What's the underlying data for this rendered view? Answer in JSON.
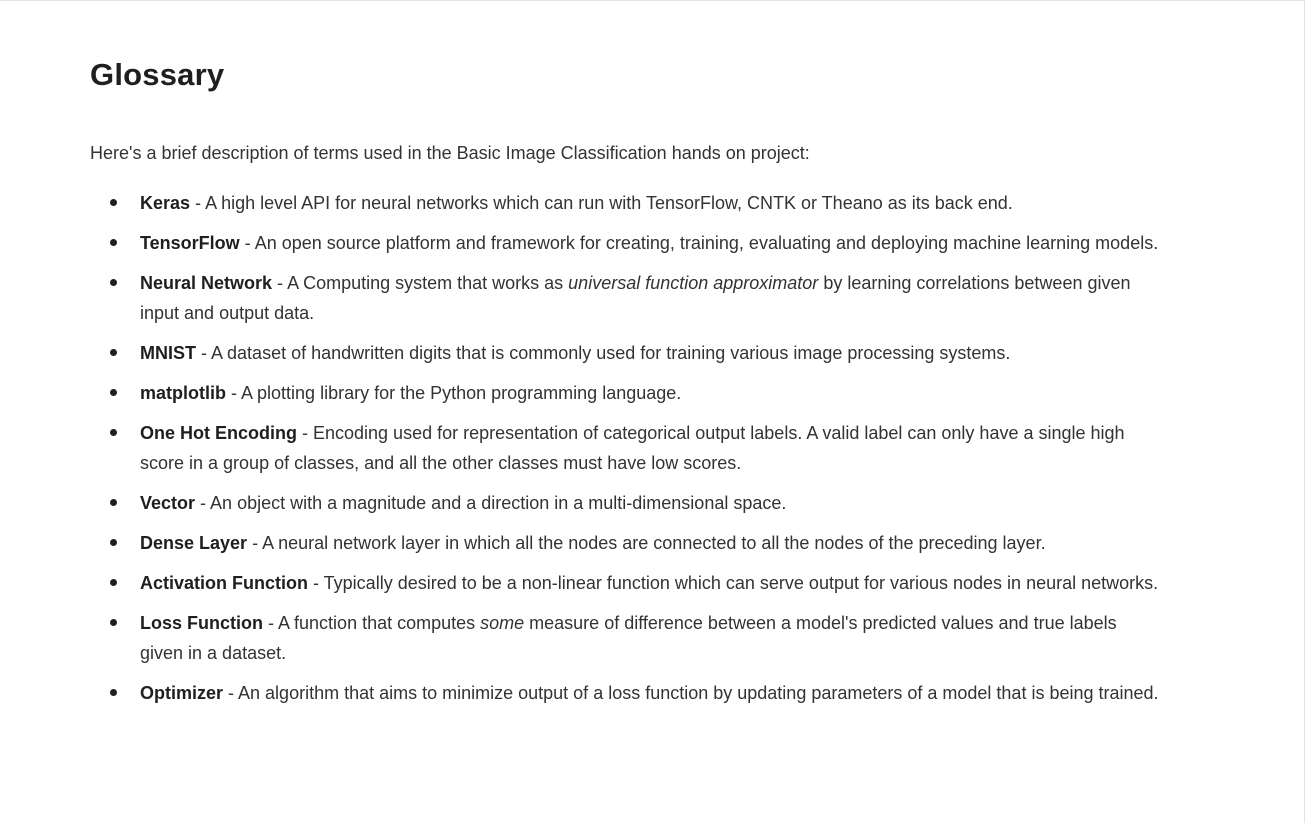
{
  "page": {
    "title": "Glossary",
    "intro": "Here's a brief description of terms used in the Basic Image Classification hands on project:"
  },
  "terms": [
    {
      "term": "Keras",
      "sep": " - ",
      "desc_before": "A high level API for neural networks which can run with TensorFlow, CNTK or Theano as its back end.",
      "emphasis": "",
      "desc_after": ""
    },
    {
      "term": "TensorFlow",
      "sep": " - ",
      "desc_before": "An open source platform and framework for creating, training, evaluating and deploying machine learning models.",
      "emphasis": "",
      "desc_after": ""
    },
    {
      "term": "Neural Network",
      "sep": " - ",
      "desc_before": "A Computing system that works as ",
      "emphasis": "universal function approximator",
      "desc_after": " by learning correlations between given input and output data."
    },
    {
      "term": "MNIST",
      "sep": " - ",
      "desc_before": "A dataset of handwritten digits that is commonly used for training various image processing systems.",
      "emphasis": "",
      "desc_after": ""
    },
    {
      "term": "matplotlib",
      "sep": " - ",
      "desc_before": "A plotting library for the Python programming language.",
      "emphasis": "",
      "desc_after": ""
    },
    {
      "term": "One Hot Encoding",
      "sep": " - ",
      "desc_before": "Encoding used for representation of categorical output labels. A valid label can only have a single high score in a group of classes, and all the other classes must have low scores.",
      "emphasis": "",
      "desc_after": ""
    },
    {
      "term": "Vector",
      "sep": " - ",
      "desc_before": "An object with a magnitude and a direction in a multi-dimensional space.",
      "emphasis": "",
      "desc_after": ""
    },
    {
      "term": "Dense Layer",
      "sep": " - ",
      "desc_before": "A neural network layer in which all the nodes are connected to all the nodes of the preceding layer.",
      "emphasis": "",
      "desc_after": ""
    },
    {
      "term": "Activation Function",
      "sep": " - ",
      "desc_before": "Typically desired to be a non-linear function which can serve output for various nodes in neural networks.",
      "emphasis": "",
      "desc_after": ""
    },
    {
      "term": "Loss Function",
      "sep": " - ",
      "desc_before": "A function that computes ",
      "emphasis": "some",
      "desc_after": " measure of difference between a model's predicted values and true labels given in a dataset."
    },
    {
      "term": "Optimizer",
      "sep": " - ",
      "desc_before": "An algorithm that aims to minimize output of a loss function by updating parameters of a model that is being trained.",
      "emphasis": "",
      "desc_after": ""
    }
  ]
}
